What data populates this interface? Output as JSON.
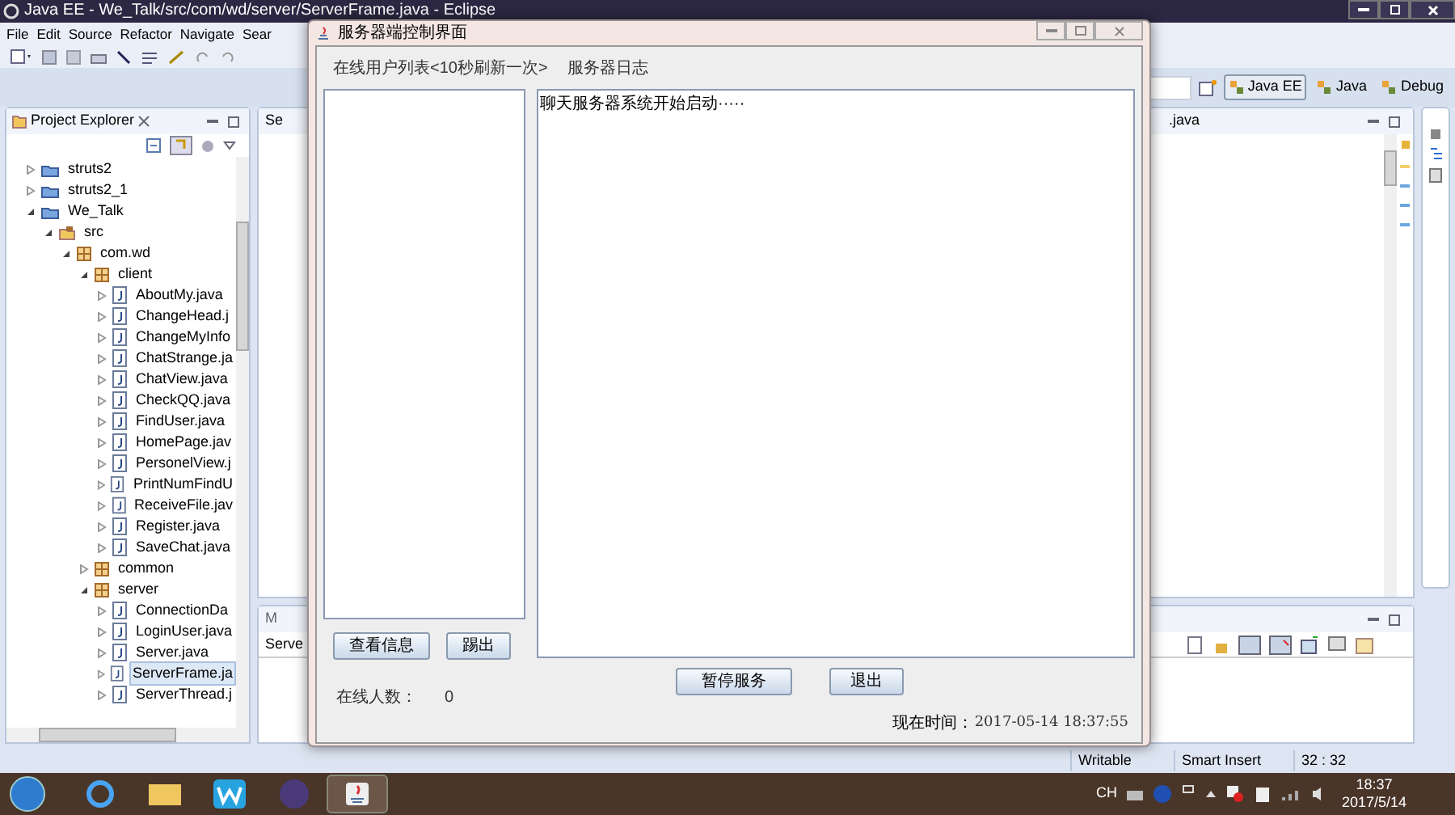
{
  "eclipse": {
    "title": "Java EE - We_Talk/src/com/wd/server/ServerFrame.java - Eclipse",
    "menu": [
      "File",
      "Edit",
      "Source",
      "Refactor",
      "Navigate",
      "Sear"
    ],
    "perspectives": [
      {
        "label": "Java EE",
        "selected": true
      },
      {
        "label": "Java",
        "selected": false
      },
      {
        "label": "Debug",
        "selected": false
      }
    ],
    "project_explorer": {
      "title": "Project Explorer",
      "tree": [
        {
          "kind": "project",
          "label": "struts2",
          "expanded": false,
          "selected": false
        },
        {
          "kind": "project",
          "label": "struts2_1",
          "expanded": false,
          "selected": false
        },
        {
          "kind": "project",
          "label": "We_Talk",
          "expanded": true,
          "selected": false,
          "children": [
            {
              "kind": "source-folder",
              "label": "src",
              "expanded": true,
              "selected": false,
              "children": [
                {
                  "kind": "package",
                  "label": "com.wd",
                  "expanded": true,
                  "selected": false,
                  "children": [
                    {
                      "kind": "package",
                      "label": "client",
                      "expanded": true,
                      "selected": false,
                      "children": [
                        {
                          "kind": "java-file",
                          "label": "AboutMy.java",
                          "expanded": false,
                          "selected": false
                        },
                        {
                          "kind": "java-file",
                          "label": "ChangeHead.j",
                          "expanded": false,
                          "selected": false
                        },
                        {
                          "kind": "java-file",
                          "label": "ChangeMyInfo",
                          "expanded": false,
                          "selected": false
                        },
                        {
                          "kind": "java-file",
                          "label": "ChatStrange.ja",
                          "expanded": false,
                          "selected": false
                        },
                        {
                          "kind": "java-file",
                          "label": "ChatView.java",
                          "expanded": false,
                          "selected": false
                        },
                        {
                          "kind": "java-file",
                          "label": "CheckQQ.java",
                          "expanded": false,
                          "selected": false
                        },
                        {
                          "kind": "java-file",
                          "label": "FindUser.java",
                          "expanded": false,
                          "selected": false
                        },
                        {
                          "kind": "java-file",
                          "label": "HomePage.jav",
                          "expanded": false,
                          "selected": false
                        },
                        {
                          "kind": "java-file",
                          "label": "PersonelView.j",
                          "expanded": false,
                          "selected": false
                        },
                        {
                          "kind": "java-file",
                          "label": "PrintNumFindU",
                          "expanded": false,
                          "selected": false
                        },
                        {
                          "kind": "java-file",
                          "label": "ReceiveFile.jav",
                          "expanded": false,
                          "selected": false
                        },
                        {
                          "kind": "java-file",
                          "label": "Register.java",
                          "expanded": false,
                          "selected": false
                        },
                        {
                          "kind": "java-file",
                          "label": "SaveChat.java",
                          "expanded": false,
                          "selected": false
                        }
                      ]
                    },
                    {
                      "kind": "package",
                      "label": "common",
                      "expanded": false,
                      "selected": false
                    },
                    {
                      "kind": "package",
                      "label": "server",
                      "expanded": true,
                      "selected": false,
                      "children": [
                        {
                          "kind": "java-file",
                          "label": "ConnectionDa",
                          "expanded": false,
                          "selected": false
                        },
                        {
                          "kind": "java-file",
                          "label": "LoginUser.java",
                          "expanded": false,
                          "selected": false
                        },
                        {
                          "kind": "java-file",
                          "label": "Server.java",
                          "expanded": false,
                          "selected": false
                        },
                        {
                          "kind": "java-file",
                          "label": "ServerFrame.ja",
                          "expanded": false,
                          "selected": true
                        },
                        {
                          "kind": "java-file",
                          "label": "ServerThread.j",
                          "expanded": false,
                          "selected": false
                        }
                      ]
                    }
                  ]
                }
              ]
            }
          ]
        }
      ]
    },
    "editor_tabs": [
      "Se",
      ".java"
    ],
    "bottom_panel": {
      "tab": "M",
      "column_1": "Serve"
    },
    "status_bar": [
      "Writable",
      "Smart Insert",
      "32 : 32"
    ]
  },
  "server_frame": {
    "title": "服务器端控制界面",
    "online_list_label": "在线用户列表<10秒刷新一次>",
    "log_label": "服务器日志",
    "log_text": "聊天服务器系统开始启动·····",
    "list_buttons": [
      "查看信息",
      "踢出"
    ],
    "online_count_label": "在线人数：",
    "online_count": "0",
    "service_buttons": [
      "暂停服务",
      "退出"
    ],
    "time_label": "现在时间：",
    "time_value": "2017-05-14 18:37:55"
  },
  "taskbar": {
    "language": "CH",
    "time": "18:37",
    "date": "2017/5/14"
  }
}
